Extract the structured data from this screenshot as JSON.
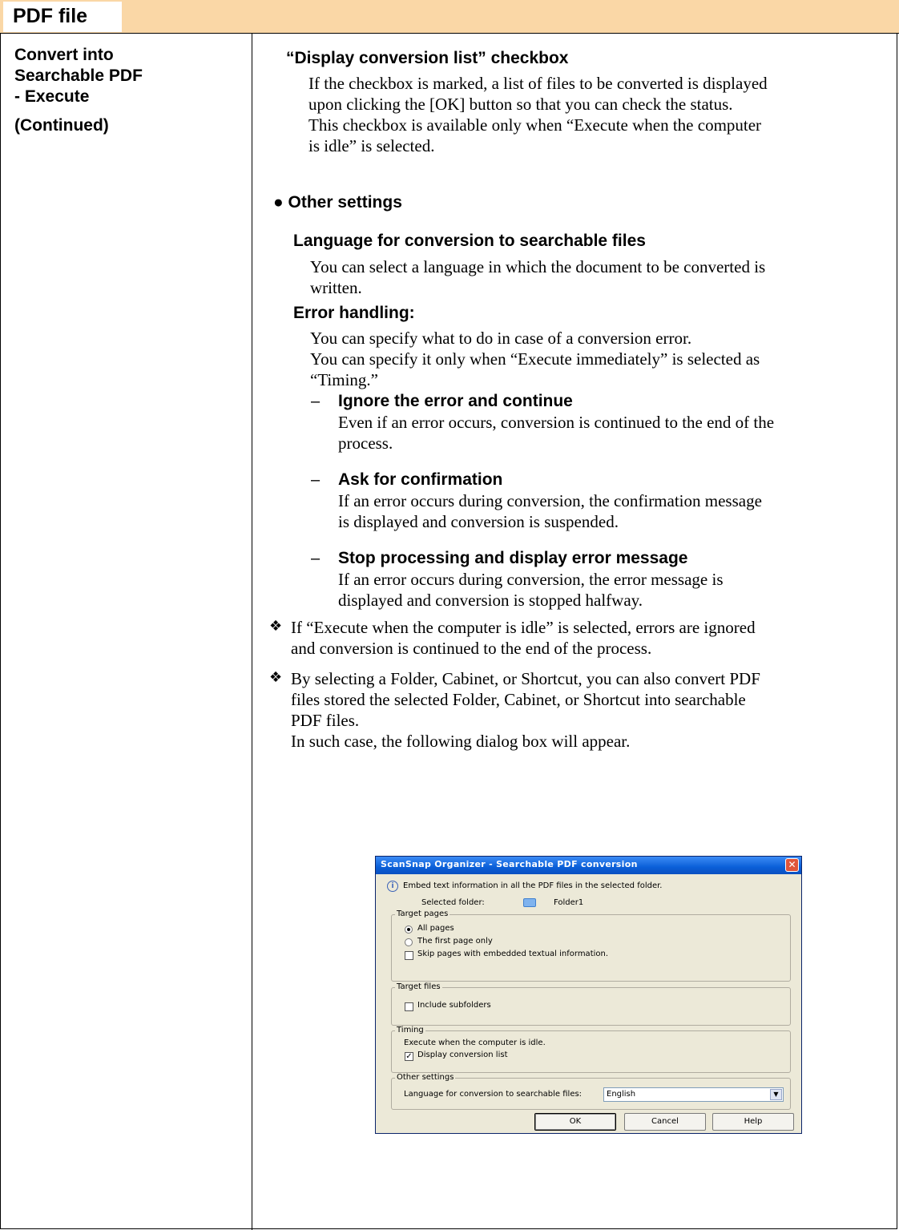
{
  "header": {
    "title": "PDF file"
  },
  "sidebar": {
    "line1": "Convert into",
    "line2": "Searchable PDF",
    "line3": "- Execute",
    "line4": "(Continued)"
  },
  "content": {
    "section1_heading": "“Display conversion list” checkbox",
    "section1_l1": "If the checkbox is marked, a list of files to be converted is displayed",
    "section1_l2": "upon clicking the [OK] button so that you can check the status.",
    "section1_l3": "This checkbox is available only when “Execute when the computer",
    "section1_l4": "is idle” is selected.",
    "other_settings_heading": "● Other settings",
    "language_heading": "Language for conversion to searchable files",
    "language_l1": "You can select a language in which the document to be converted is",
    "language_l2": "written.",
    "error_heading": "Error handling:",
    "error_l1": "You can specify what to do in case of a conversion error.",
    "error_l2": "You can specify it only when “Execute immediately” is selected as",
    "error_l3": "“Timing.”",
    "options": [
      {
        "dash": "–",
        "title": "Ignore the error and continue",
        "l1": "Even if an error occurs, conversion is continued to the end of the",
        "l2": "process."
      },
      {
        "dash": "–",
        "title": "Ask for confirmation",
        "l1": "If an error occurs during conversion, the confirmation message",
        "l2": "is displayed and conversion is suspended."
      },
      {
        "dash": "–",
        "title": "Stop processing and display error message",
        "l1": "If an error occurs during conversion, the error message is",
        "l2": "displayed and conversion is stopped halfway."
      }
    ],
    "note1_bullet": "❖",
    "note1_l1": "If “Execute when the computer is idle” is selected, errors are ignored",
    "note1_l2": "and conversion is continued to the end of the process.",
    "note2_bullet": "❖",
    "note2_l1": "By selecting a Folder, Cabinet, or Shortcut, you can also convert PDF",
    "note2_l2": "files stored the selected Folder, Cabinet, or Shortcut into searchable",
    "note2_l3": "PDF files.",
    "note2_l4": "In such case, the following dialog box will appear."
  },
  "dialog": {
    "title": "ScanSnap Organizer - Searchable PDF conversion",
    "close_glyph": "✕",
    "info_text": "Embed text information in all the PDF files in the selected folder.",
    "selected_folder_label": "Selected folder:",
    "selected_folder_value": "Folder1",
    "target_pages_label": "Target pages",
    "all_pages": "All pages",
    "first_page_only": "The first page only",
    "skip_pages": "Skip pages with embedded textual information.",
    "target_files_label": "Target files",
    "include_subfolders": "Include subfolders",
    "timing_label": "Timing",
    "timing_text": "Execute when the computer is idle.",
    "display_conversion_list": "Display conversion list",
    "other_settings_label": "Other settings",
    "language_label": "Language for conversion to searchable files:",
    "language_value": "English",
    "ok": "OK",
    "cancel": "Cancel",
    "help": "Help",
    "all_pages_selected": true,
    "skip_pages_checked": false,
    "include_subfolders_checked": false,
    "display_conversion_list_checked": true
  }
}
